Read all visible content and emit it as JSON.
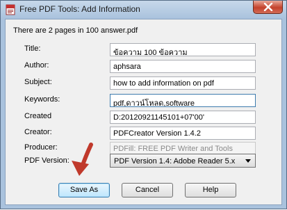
{
  "window": {
    "title": "Free PDF Tools: Add Information"
  },
  "header": {
    "text": "There are 2 pages in 100 answer.pdf"
  },
  "fields": [
    {
      "label": "Title:",
      "value": "ข้อความ 100 ข้อความ"
    },
    {
      "label": "Author:",
      "value": "aphsara"
    },
    {
      "label": "Subject:",
      "value": "how to add information on pdf"
    },
    {
      "label": "Keywords:",
      "value": "pdf,ดาวน์โหลด,software"
    },
    {
      "label": "Created",
      "value": "D:20120921145101+07'00'"
    },
    {
      "label": "Creator:",
      "value": "PDFCreator Version 1.4.2"
    },
    {
      "label": "Producer:",
      "value": "PDFill: FREE PDF Writer and Tools"
    }
  ],
  "pdf_version": {
    "label": "PDF Version:",
    "selected": "PDF Version 1.4: Adobe Reader 5.x"
  },
  "buttons": {
    "save_as": "Save As",
    "cancel": "Cancel",
    "help": "Help"
  },
  "colors": {
    "annotation_arrow": "#c0392b",
    "default_button_border": "#3c7fb1"
  }
}
